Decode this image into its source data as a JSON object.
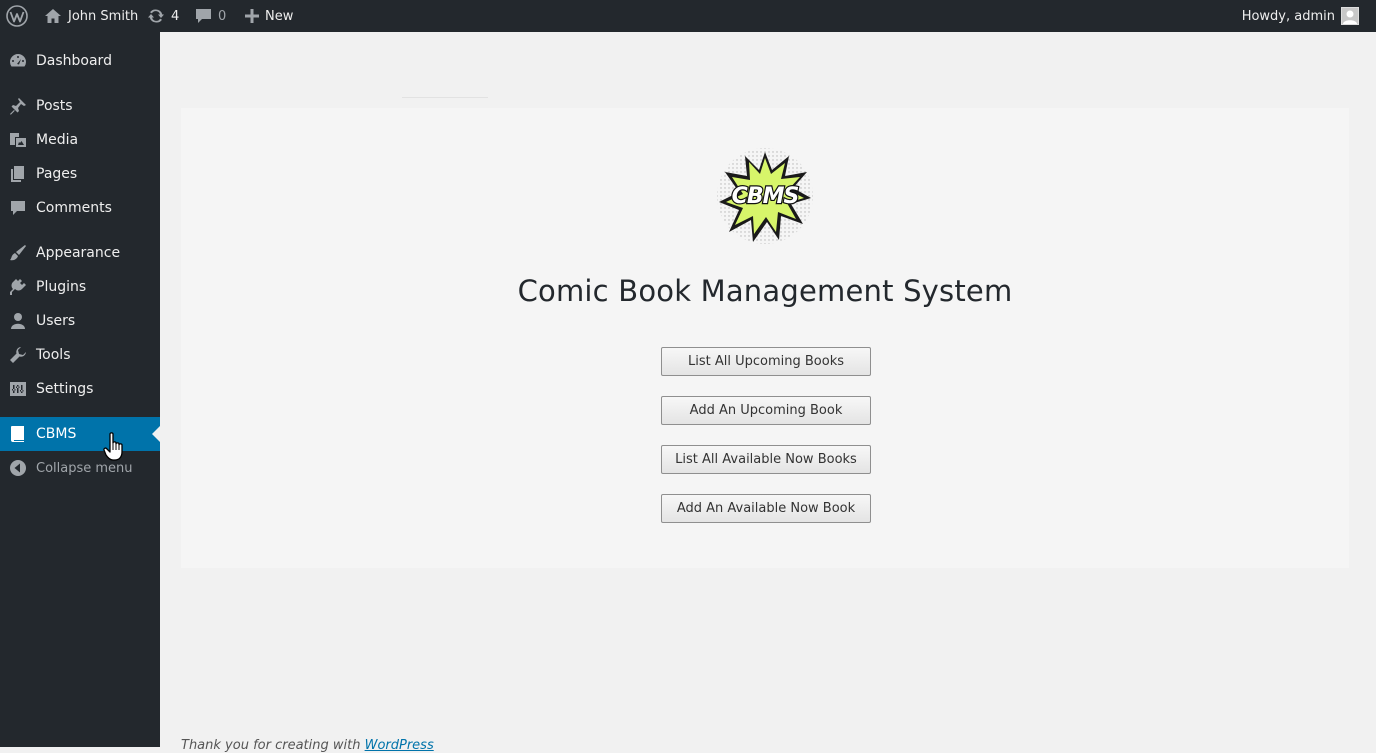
{
  "adminbar": {
    "site_name": "John Smith",
    "updates_count": "4",
    "comments_count": "0",
    "new_label": "New",
    "greeting": "Howdy, admin"
  },
  "menu": {
    "items": [
      {
        "label": "Dashboard",
        "icon": "dashboard-icon"
      },
      {
        "label": "Posts",
        "icon": "pin-icon"
      },
      {
        "label": "Media",
        "icon": "media-icon"
      },
      {
        "label": "Pages",
        "icon": "pages-icon"
      },
      {
        "label": "Comments",
        "icon": "comment-icon"
      },
      {
        "label": "Appearance",
        "icon": "brush-icon"
      },
      {
        "label": "Plugins",
        "icon": "plug-icon"
      },
      {
        "label": "Users",
        "icon": "user-icon"
      },
      {
        "label": "Tools",
        "icon": "wrench-icon"
      },
      {
        "label": "Settings",
        "icon": "settings-icon"
      },
      {
        "label": "CBMS",
        "icon": "book-icon",
        "current": true
      }
    ],
    "collapse_label": "Collapse menu"
  },
  "main": {
    "logo_text": "CBMS",
    "title": "Comic Book Management System",
    "buttons": [
      "List All Upcoming Books",
      "Add An Upcoming Book",
      "List All Available Now Books",
      "Add An Available Now Book"
    ]
  },
  "footer": {
    "text": "Thank you for creating with",
    "link": "WordPress"
  },
  "colors": {
    "adminbar_bg": "#23282d",
    "menu_current": "#0073aa",
    "logo_burst": "#d7f56a"
  }
}
